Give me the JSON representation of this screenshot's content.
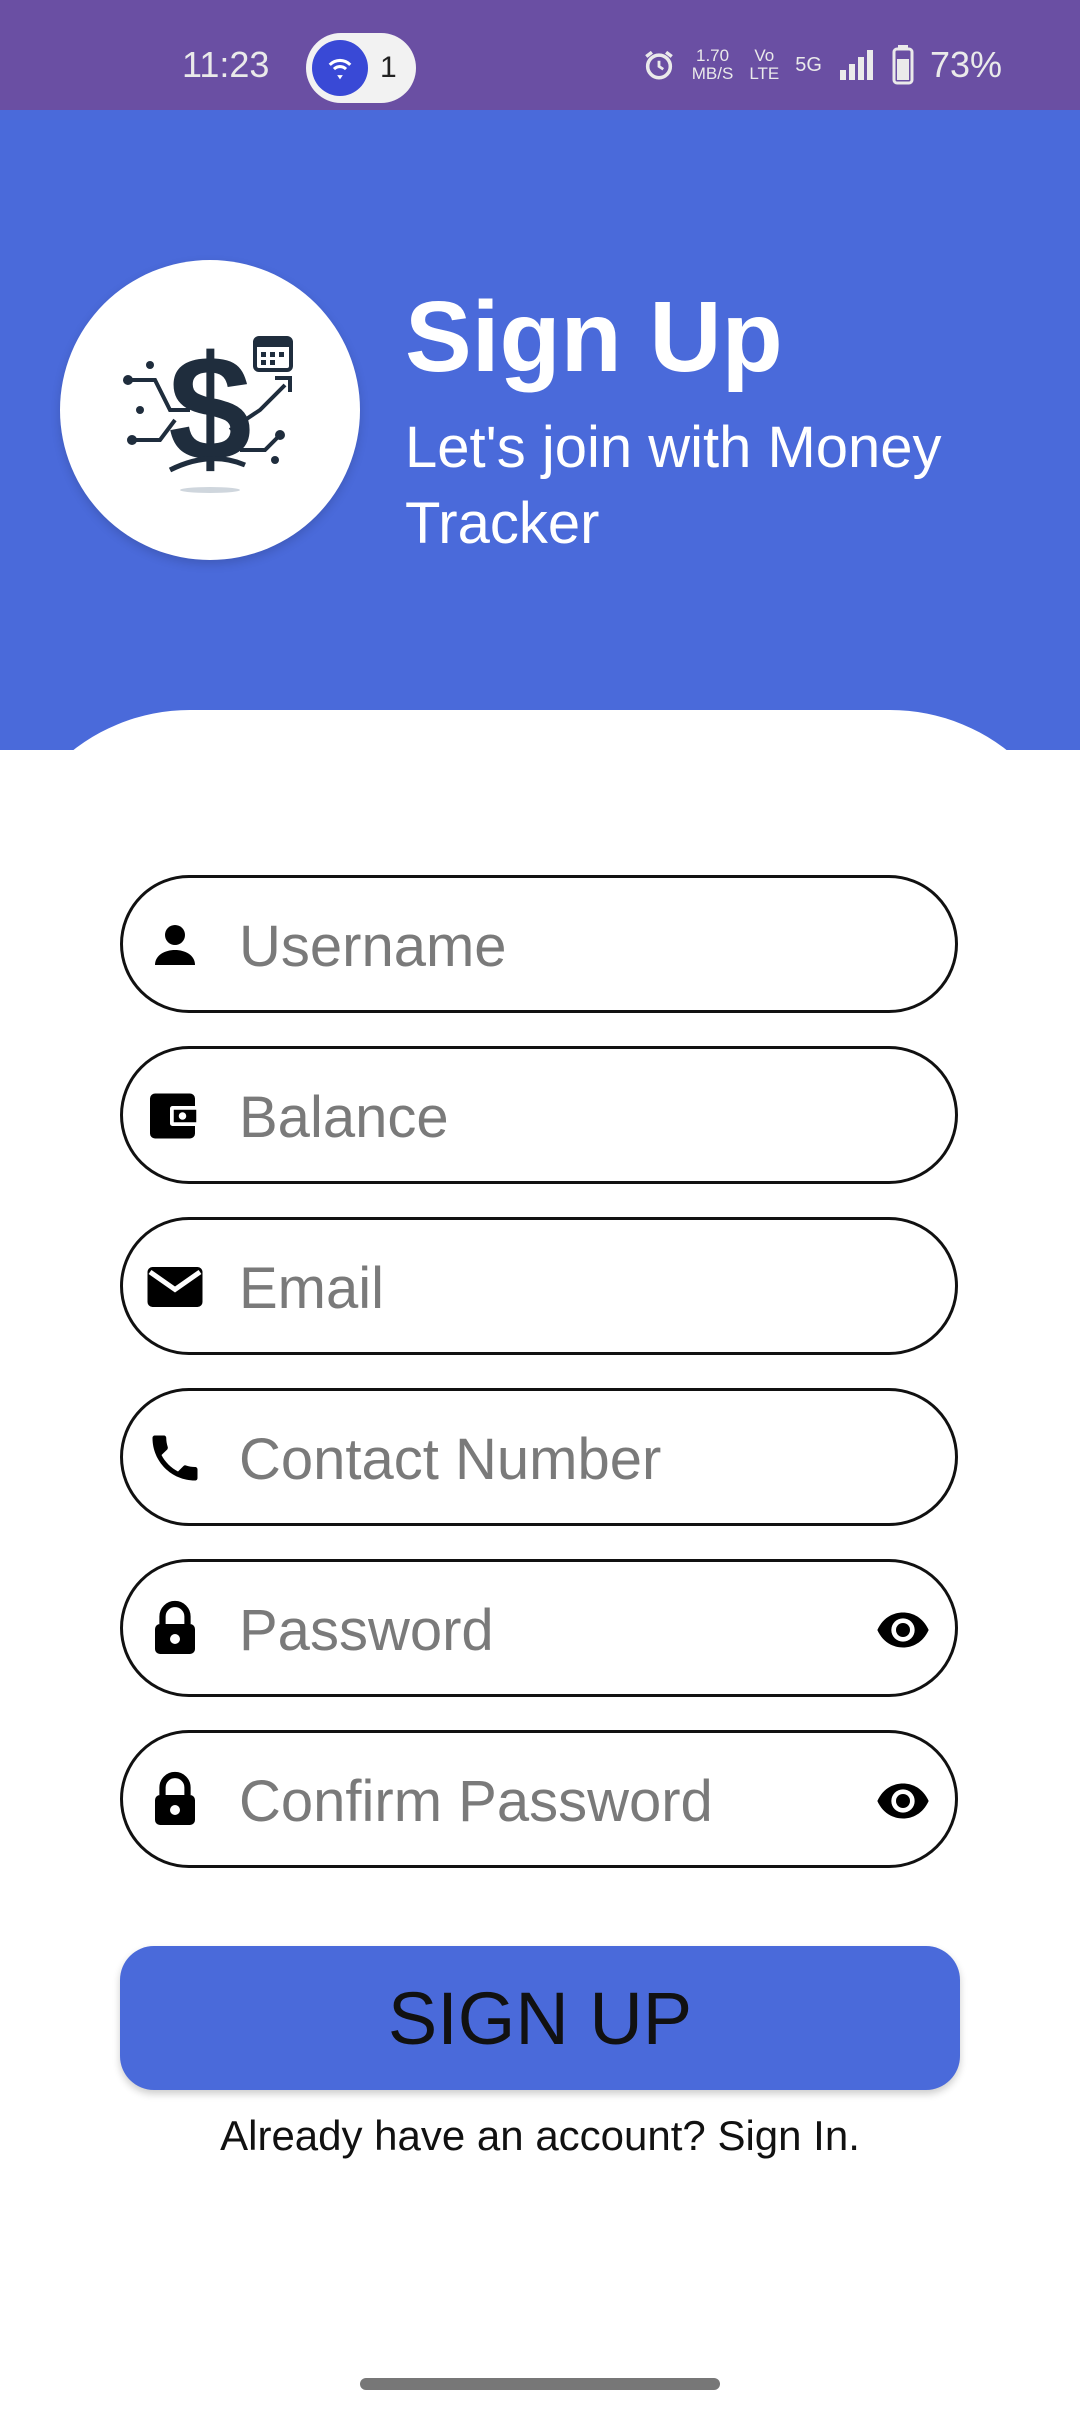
{
  "status_bar": {
    "time": "11:23",
    "hotspot_count": "1",
    "speed_value": "1.70",
    "speed_unit": "MB/S",
    "volte_top": "Vo",
    "volte_bottom": "LTE",
    "network": "5G",
    "battery": "73%"
  },
  "header": {
    "title": "Sign Up",
    "subtitle": "Let's join with Money Tracker"
  },
  "form": {
    "username_placeholder": "Username",
    "balance_placeholder": "Balance",
    "email_placeholder": "Email",
    "contact_placeholder": "Contact Number",
    "password_placeholder": "Password",
    "confirm_password_placeholder": "Confirm Password",
    "submit_label": "SIGN UP",
    "signin_prompt": "Already have an account? Sign In."
  },
  "colors": {
    "status_bar": "#6a4fa3",
    "header": "#4a6ada",
    "button": "#4a6ada"
  }
}
